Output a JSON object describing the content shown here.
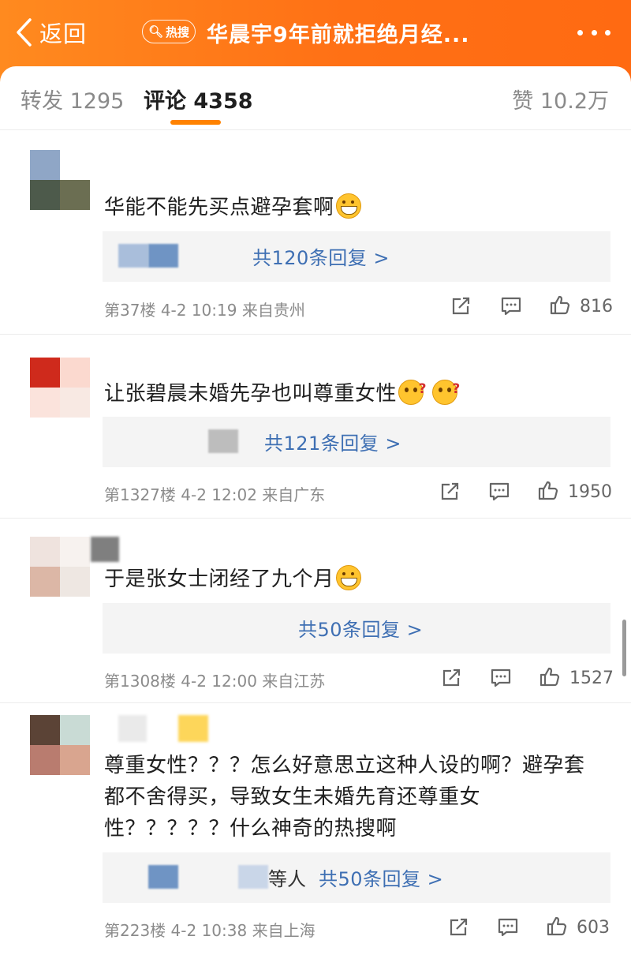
{
  "header": {
    "back_label": "返回",
    "hot_badge": "热搜",
    "title": "华晨宇9年前就拒绝月经...",
    "bg_color": "#ff7a19"
  },
  "tabs": {
    "forward": "转发 1295",
    "comments": "评论 4358",
    "likes": "赞 10.2万",
    "active": "comments",
    "accent_color": "#ff8200"
  },
  "comments": [
    {
      "text": "华能不能先买点避孕套啊",
      "emojis": [
        "grin"
      ],
      "reply_prefix": "",
      "replies": "共120条回复 >",
      "floor": "第37楼",
      "time": "4-2 10:19",
      "location": "来自贵州",
      "likes": "816"
    },
    {
      "text": "让张碧晨未婚先孕也叫尊重女性",
      "emojis": [
        "ask",
        "ask"
      ],
      "reply_prefix": "",
      "replies": "共121条回复 >",
      "floor": "第1327楼",
      "time": "4-2 12:02",
      "location": "来自广东",
      "likes": "1950"
    },
    {
      "text": "于是张女士闭经了九个月",
      "emojis": [
        "grin"
      ],
      "reply_prefix": "",
      "replies": "共50条回复 >",
      "floor": "第1308楼",
      "time": "4-2 12:00",
      "location": "来自江苏",
      "likes": "1527"
    },
    {
      "lines": [
        "尊重女性？？？怎么好意思立这种人设的啊？避孕套",
        "都不舍得买，导致女生未婚先育还尊重女",
        "性？？？？？什么神奇的热搜啊"
      ],
      "reply_prefix": "等人",
      "replies": "共50条回复 >",
      "floor": "第223楼",
      "time": "4-2 10:38",
      "location": "来自上海",
      "likes": "603"
    }
  ],
  "icons": {
    "back": "chevron-left-icon",
    "more": "more-dots-icon",
    "share": "share-icon",
    "comment": "comment-icon",
    "like": "thumbs-up-icon"
  },
  "link_color": "#3e6fb3"
}
